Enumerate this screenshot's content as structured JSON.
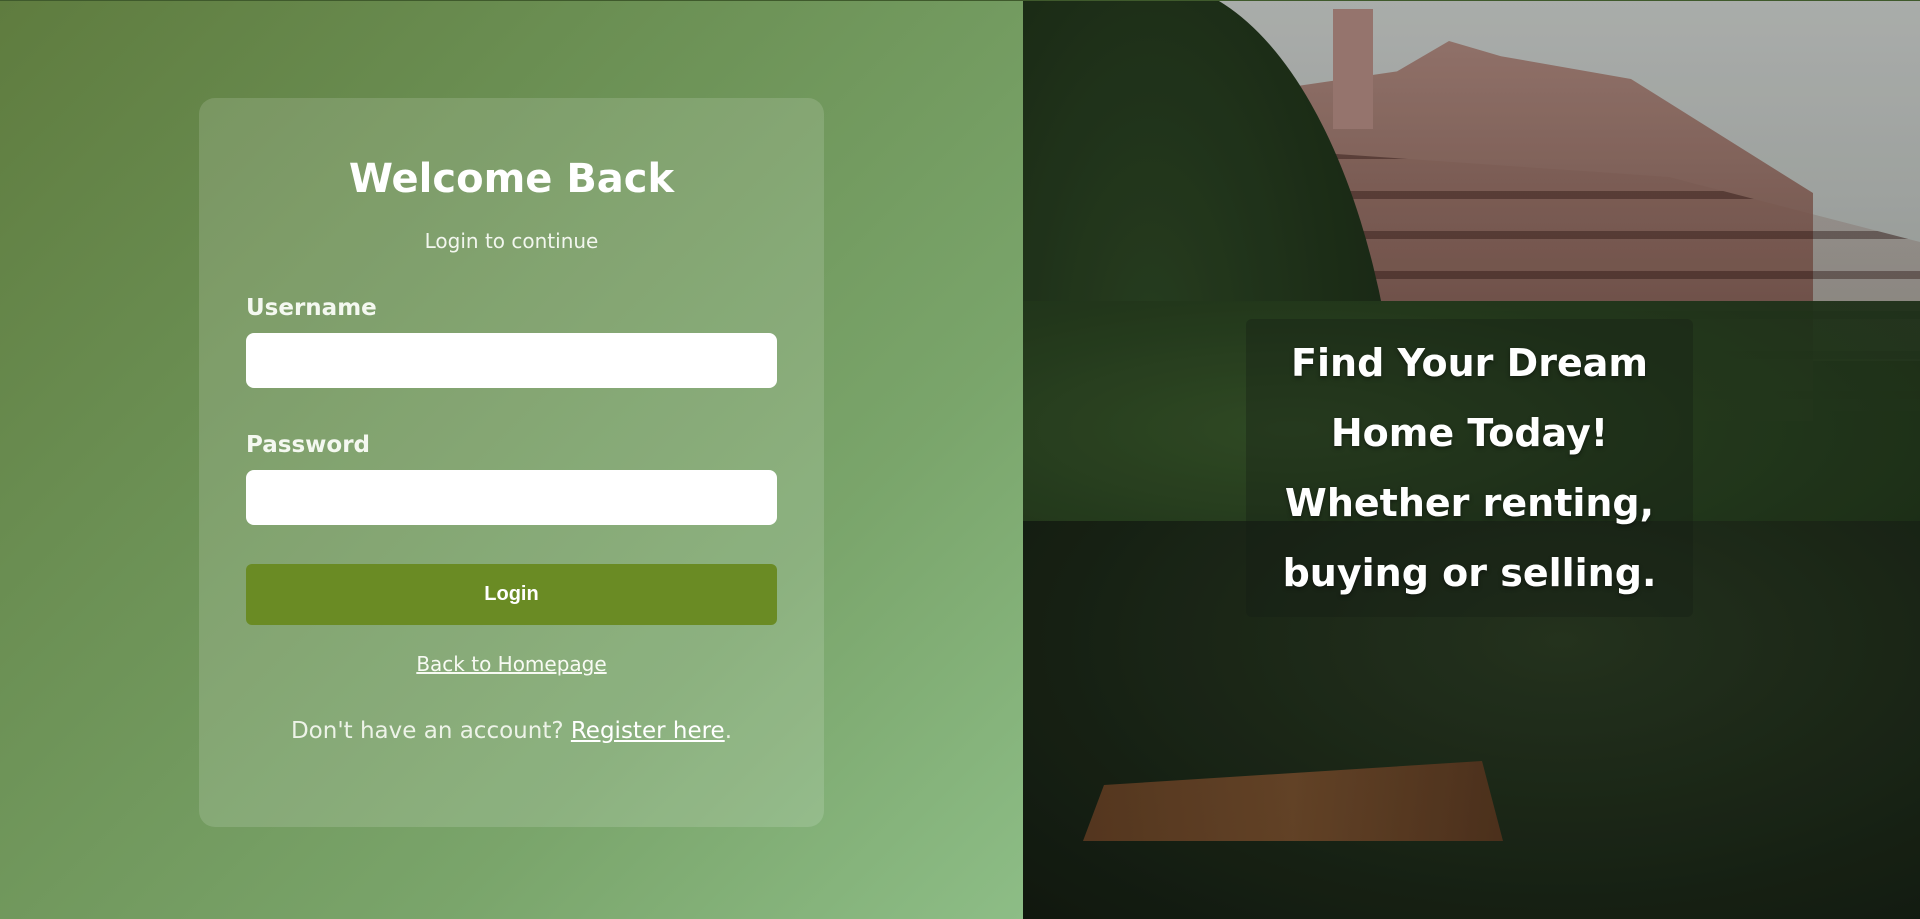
{
  "login": {
    "title": "Welcome Back",
    "subtitle": "Login to continue",
    "username_label": "Username",
    "username_value": "",
    "password_label": "Password",
    "password_value": "",
    "login_button": "Login",
    "back_link": "Back to Homepage",
    "register_prompt": "Don't have an account? ",
    "register_link": "Register here",
    "register_suffix": "."
  },
  "hero": {
    "tagline": "Find Your Dream Home Today! Whether renting, buying or selling."
  },
  "colors": {
    "left_gradient_start": "#5f7c3f",
    "left_gradient_end": "#8dbd86",
    "button": "#6a8b24",
    "text": "#ffffff"
  }
}
